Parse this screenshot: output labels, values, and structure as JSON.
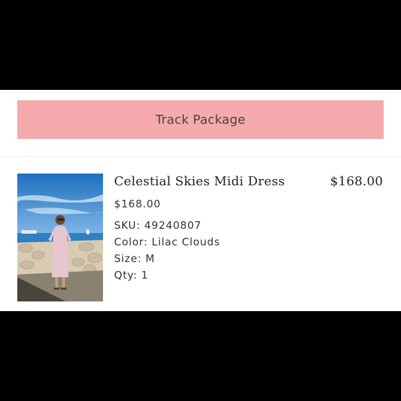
{
  "actions": {
    "track_package_label": "Track Package"
  },
  "item": {
    "name": "Celestial Skies Midi Dress",
    "line_total": "$168.00",
    "unit_price": "$168.00",
    "sku": "SKU: 49240807",
    "color": "Color: Lilac Clouds",
    "size": "Size: M",
    "qty": "Qty: 1"
  },
  "colors": {
    "page_background": "#000000",
    "panel_background": "#ffffff",
    "button_background": "#f5aaad",
    "text": "#333333"
  },
  "icons": {
    "product_image": "product-photo"
  }
}
